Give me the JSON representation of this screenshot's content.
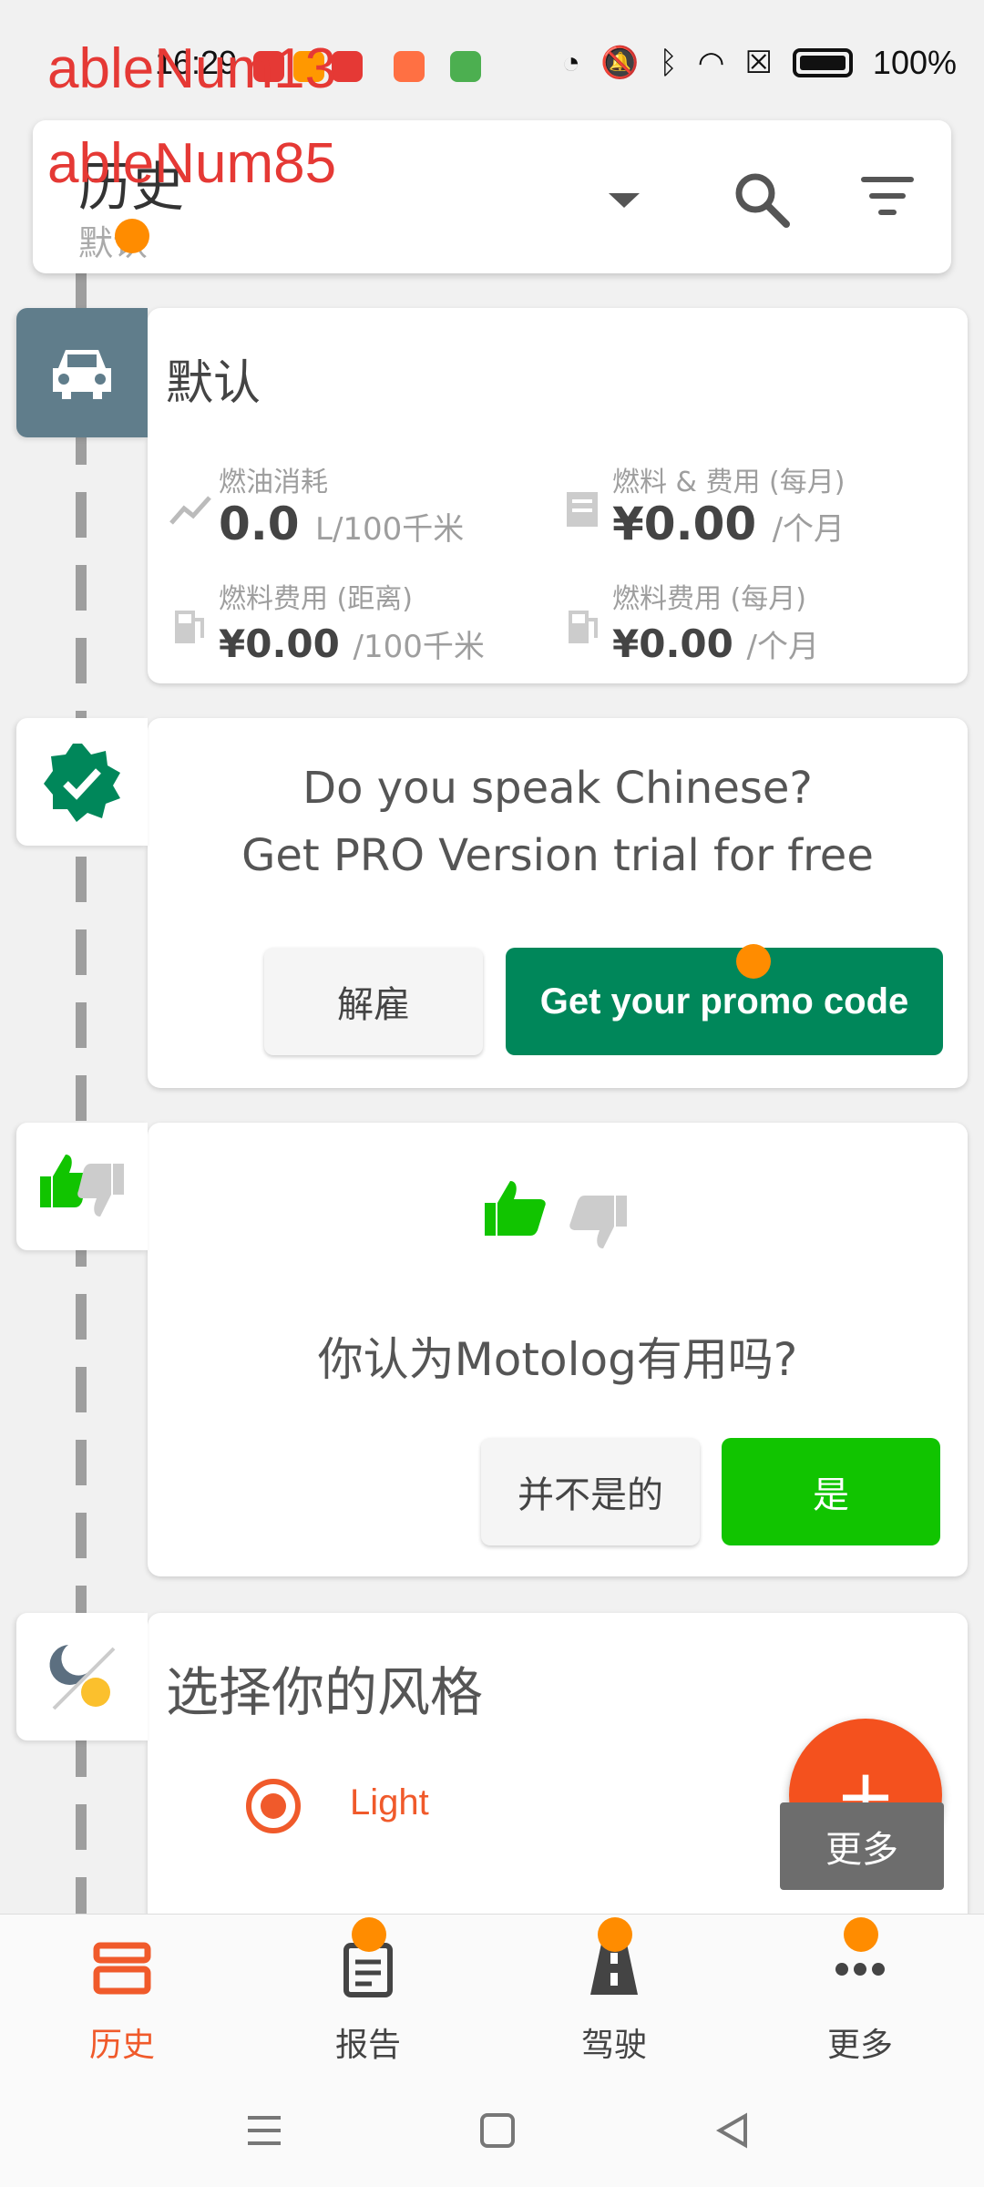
{
  "status_bar": {
    "time": "16:29",
    "battery": "100%"
  },
  "overlays": {
    "label_top": "ableNum13",
    "label_title": "ableNum85"
  },
  "header": {
    "title": "历史",
    "subtitle": "默认"
  },
  "vehicle_card": {
    "title": "默认",
    "stats": [
      {
        "label": "燃油消耗",
        "value": "0.0",
        "unit": "L/100千米"
      },
      {
        "label": "燃料 & 费用 (每月)",
        "value": "¥0.00",
        "unit": "/个月"
      },
      {
        "label": "燃料费用 (距离)",
        "value": "¥0.00",
        "unit": "/100千米"
      },
      {
        "label": "燃料费用 (每月)",
        "value": "¥0.00",
        "unit": "/个月"
      }
    ]
  },
  "promo_card": {
    "line1": "Do you speak Chinese?",
    "line2": "Get PRO Version trial for free",
    "dismiss_label": "解雇",
    "cta_label": "Get your promo code"
  },
  "rating_card": {
    "question": "你认为Motolog有用吗?",
    "no_label": "并不是的",
    "yes_label": "是"
  },
  "style_card": {
    "title": "选择你的风格",
    "option_selected": "Light"
  },
  "fab": {
    "label": "+",
    "tooltip": "更多"
  },
  "bottom_nav": [
    {
      "label": "历史",
      "icon": "history-icon",
      "active": true
    },
    {
      "label": "报告",
      "icon": "report-icon",
      "active": false
    },
    {
      "label": "驾驶",
      "icon": "road-icon",
      "active": false
    },
    {
      "label": "更多",
      "icon": "more-icon",
      "active": false
    }
  ],
  "colors": {
    "accent": "#f05a2b",
    "promo_green": "#00875a",
    "yes_green": "#11c400",
    "vehicle_badge": "#607d8b"
  }
}
